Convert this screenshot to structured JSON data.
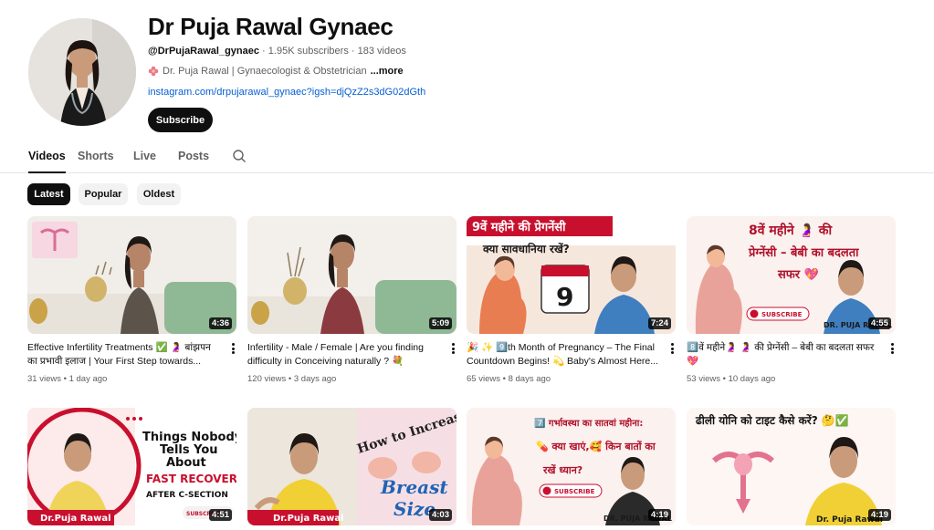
{
  "channel": {
    "name": "Dr Puja Rawal Gynaec",
    "handle": "@DrPujaRawal_gynaec",
    "subscribers": "1.95K subscribers",
    "videos_count": "183 videos",
    "separator": " · ",
    "description": "Dr. Puja Rawal | Gynaecologist & Obstetrician",
    "more_label": "...more",
    "link": "instagram.com/drpujarawal_gynaec?igsh=djQzZ2s3dG02dGth",
    "subscribe_label": "Subscribe"
  },
  "tabs": [
    {
      "label": "Videos",
      "active": true
    },
    {
      "label": "Shorts",
      "active": false
    },
    {
      "label": "Live",
      "active": false
    },
    {
      "label": "Posts",
      "active": false
    }
  ],
  "chips": [
    {
      "label": "Latest",
      "active": true
    },
    {
      "label": "Popular",
      "active": false
    },
    {
      "label": "Oldest",
      "active": false
    }
  ],
  "videos": [
    {
      "title": "Effective Infertility Treatments ✅ 🤰 बांझपन का प्रभावी इलाज | Your First Step towards...",
      "views": "31 views",
      "age": "1 day ago",
      "duration": "4:36",
      "thumb_text": ""
    },
    {
      "title": "Infertility - Male / Female | Are you finding difficulty in Conceiving naturally ? 💐",
      "views": "120 views",
      "age": "3 days ago",
      "duration": "5:09",
      "thumb_text": ""
    },
    {
      "title": "🎉 ✨ 9️⃣th Month of Pregnancy – The Final Countdown Begins! 💫 Baby's Almost Here...",
      "views": "65 views",
      "age": "8 days ago",
      "duration": "7:24",
      "thumb_text": "9वें महीने की प्रेगनेंसी",
      "thumb_text2": "क्या सावधानिया रखें?",
      "thumb_num": "9"
    },
    {
      "title": "8️⃣वें महीने🤰 🤰 की प्रेग्नेंसी – बेबी का बदलता सफर 💖",
      "views": "53 views",
      "age": "10 days ago",
      "duration": "4:55",
      "thumb_text": "8वें महीने 🤰 की",
      "thumb_text2": "प्रेग्नेंसी – बेबी का बदलता",
      "thumb_text3": "सफर 💖",
      "thumb_sub": "SUBSCRIBE",
      "thumb_name": "DR. PUJA RAWAL"
    },
    {
      "title": "",
      "views": "",
      "age": "",
      "duration": "4:51",
      "thumb_text": "Things Nobody",
      "thumb_text2": "Tells You",
      "thumb_text3": "About",
      "thumb_text4": "FAST RECOVERY",
      "thumb_text5": "AFTER C-SECTION",
      "thumb_name": "Dr.Puja Rawal",
      "thumb_sub": "SUBSCRIBE"
    },
    {
      "title": "",
      "views": "",
      "age": "",
      "duration": "4:03",
      "thumb_text": "How to Increase",
      "thumb_text2": "Breast",
      "thumb_text3": "Size",
      "thumb_name": "Dr.Puja Rawal"
    },
    {
      "title": "",
      "views": "",
      "age": "",
      "duration": "4:19",
      "thumb_text": "7️⃣ गर्भावस्था का सातवां महीना:",
      "thumb_text2": "💊 क्या खाएं,🥰 किन बातों का",
      "thumb_text3": "रखें ध्यान?",
      "thumb_sub": "SUBSCRIBE",
      "thumb_name": "DR. PUJA RAWAL"
    },
    {
      "title": "",
      "views": "",
      "age": "",
      "duration": "4:19",
      "thumb_text": "ढीली योनि को टाइट कैसे करें? 🤔✅",
      "thumb_name": "Dr. Puja Rawal"
    }
  ],
  "colors": {
    "accent": "#0f0f0f",
    "link": "#065fd4",
    "muted": "#606060",
    "chip_bg": "#f2f2f2",
    "sofa_green": "#8fb894",
    "thumb_red": "#c8102e"
  },
  "icons": [
    "flower-icon",
    "search-icon",
    "kebab-icon"
  ]
}
